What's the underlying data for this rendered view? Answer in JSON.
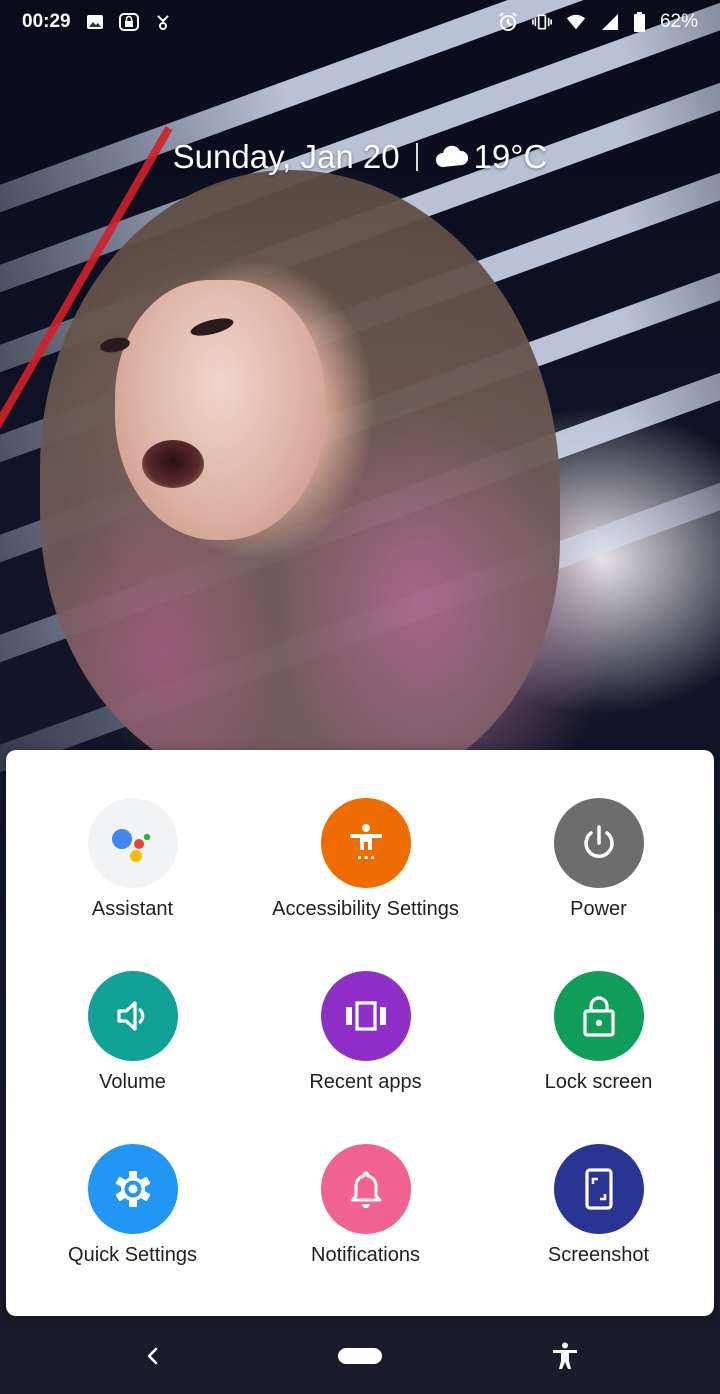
{
  "status_bar": {
    "time": "00:29",
    "battery": "62%",
    "left_icons": [
      "gallery-icon",
      "vpn-lock-icon",
      "hotspot-icon"
    ],
    "right_icons": [
      "alarm-icon",
      "vibrate-icon",
      "wifi-icon",
      "signal-icon",
      "battery-icon"
    ]
  },
  "glance": {
    "date": "Sunday, Jan 20",
    "weather_icon": "cloud-icon",
    "temperature": "19°C"
  },
  "accessibility_menu": {
    "items": [
      {
        "label": "Assistant",
        "icon": "assistant-icon",
        "color": "#F1F3F4"
      },
      {
        "label": "Accessibility Settings",
        "icon": "accessibility-icon",
        "color": "#EF6C00"
      },
      {
        "label": "Power",
        "icon": "power-icon",
        "color": "#6D6D6D"
      },
      {
        "label": "Volume",
        "icon": "volume-icon",
        "color": "#12A196"
      },
      {
        "label": "Recent apps",
        "icon": "recent-apps-icon",
        "color": "#8E30C8"
      },
      {
        "label": "Lock screen",
        "icon": "lock-icon",
        "color": "#0F9D58"
      },
      {
        "label": "Quick Settings",
        "icon": "gear-icon",
        "color": "#2196F3"
      },
      {
        "label": "Notifications",
        "icon": "bell-icon",
        "color": "#F06292"
      },
      {
        "label": "Screenshot",
        "icon": "screenshot-icon",
        "color": "#283593"
      }
    ]
  },
  "nav_bar": {
    "buttons": [
      "back-icon",
      "home-pill",
      "accessibility-icon"
    ]
  }
}
